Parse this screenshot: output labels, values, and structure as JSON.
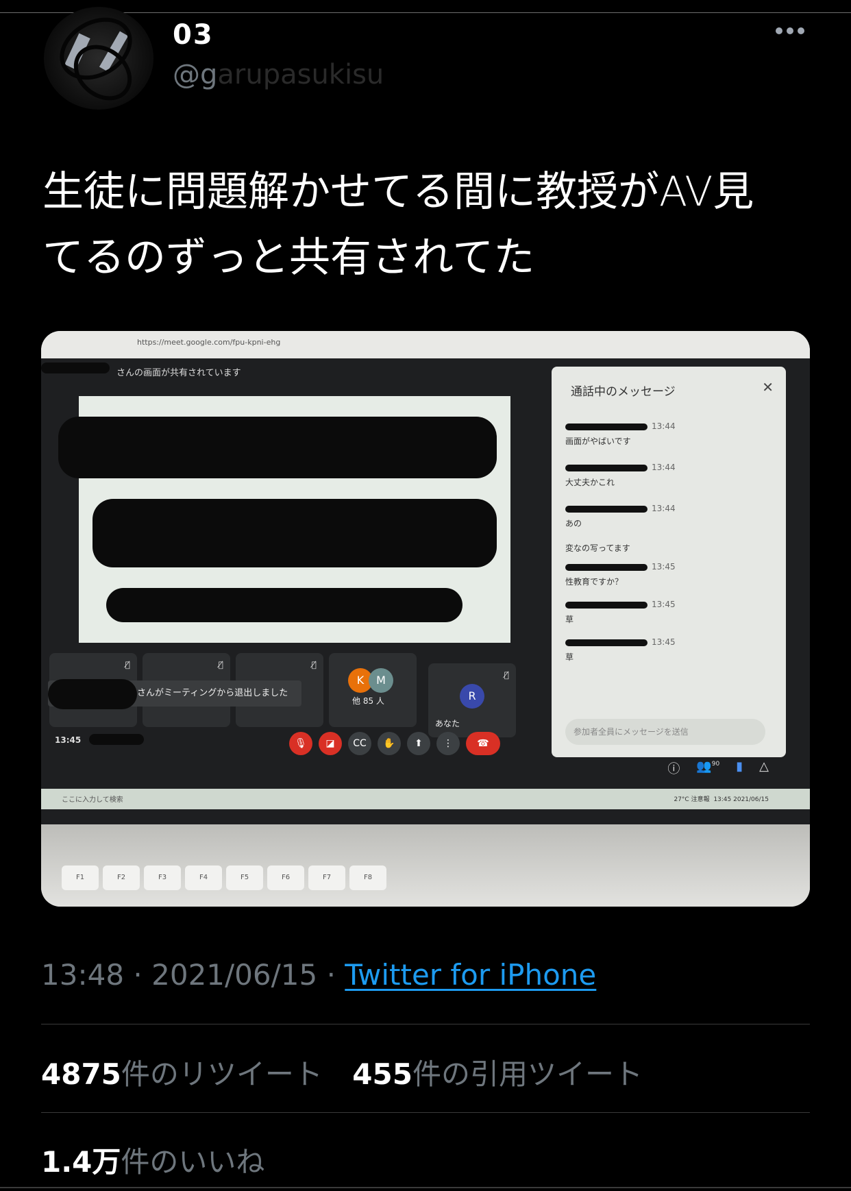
{
  "author": {
    "display_name": "03",
    "handle": "@garupasukisu",
    "handle_visible_prefix": "@g",
    "handle_dim_rest": "arupasukisu"
  },
  "tweet": {
    "text_line1": "生徒に問題解かせてる間に教授がAV見",
    "text_line2": "てるのずっと共有されてた"
  },
  "media": {
    "browser_url": "https://meet.google.com/fpu-kpni-ehg",
    "share_banner": "さんの画面が共有されています",
    "chat": {
      "title": "通話中のメッセージ",
      "close_icon": "close-icon",
      "messages": [
        {
          "time": "13:44",
          "text": "画面がやばいです"
        },
        {
          "time": "13:44",
          "text": "大丈夫かこれ"
        },
        {
          "time": "13:44",
          "text": "あの"
        },
        {
          "time": "",
          "text": "変なの写ってます"
        },
        {
          "time": "13:45",
          "text": "性教育ですか？"
        },
        {
          "time": "13:45",
          "text": "草"
        },
        {
          "time": "13:45",
          "text": "草"
        }
      ],
      "input_placeholder": "参加者全員にメッセージを送信"
    },
    "tiles": {
      "others_label": "他 85 人",
      "others_avatars": [
        "K",
        "M"
      ],
      "self_label": "あなた",
      "self_avatar": "R"
    },
    "toast": "さんがミーティングから退出しました",
    "clock": "13:45",
    "participant_count": "90",
    "taskbar_search": "ここに入力して検索",
    "weather": "27°C 注意報",
    "tray_time": "13:45",
    "tray_date": "2021/06/15",
    "function_keys": [
      "F1",
      "F2",
      "F3",
      "F4",
      "F5",
      "F6",
      "F7",
      "F8"
    ]
  },
  "meta": {
    "time": "13:48",
    "date": "2021/06/15",
    "separator": "·",
    "source": "Twitter for iPhone"
  },
  "stats": {
    "retweets_count": "4875",
    "retweets_label": "件のリツイート",
    "quotes_count": "455",
    "quotes_label": "件の引用ツイート",
    "likes_count": "1.4万",
    "likes_label": "件のいいね"
  },
  "colors": {
    "background": "#000000",
    "link": "#1d9bf0",
    "secondary_text": "#6e767d",
    "meet_red": "#d93025"
  }
}
